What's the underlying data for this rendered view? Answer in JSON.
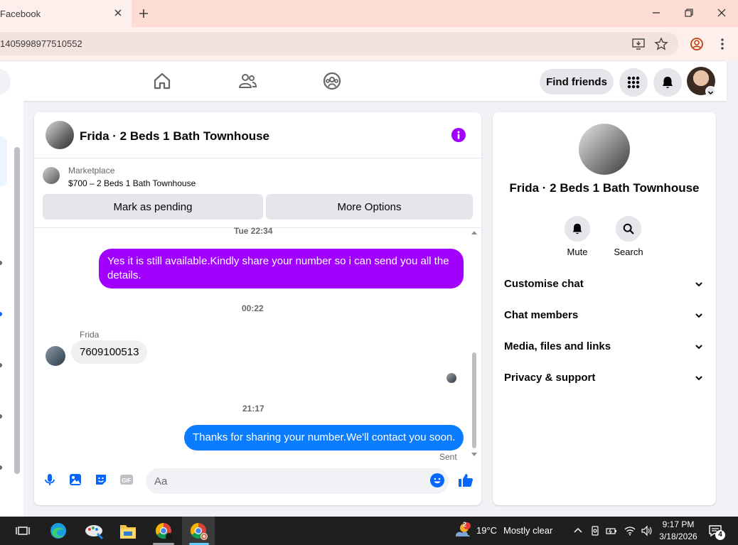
{
  "browser": {
    "tab_title": "Facebook",
    "url": "1405998977510552"
  },
  "fb_nav": {
    "find_friends_label": "Find friends"
  },
  "chat": {
    "title": "Frida · 2 Beds 1 Bath Townhouse",
    "listing": {
      "source": "Marketplace",
      "price_title": "$700 – 2 Beds 1 Bath Townhouse",
      "mark_pending_label": "Mark as pending",
      "more_options_label": "More Options"
    },
    "messages": [
      {
        "type": "timestamp",
        "text": "Tue 22:34"
      },
      {
        "type": "outgoing",
        "color": "#a100ff",
        "text": "Yes it is still available.Kindly share your number so i can send you all the details."
      },
      {
        "type": "timestamp",
        "text": "00:22"
      },
      {
        "type": "incoming",
        "sender": "Frida",
        "text": "7609100513"
      },
      {
        "type": "timestamp",
        "text": "21:17"
      },
      {
        "type": "outgoing",
        "color": "#0a7cff",
        "text": "Thanks for sharing your number.We'll contact you soon.",
        "status": "Sent"
      }
    ],
    "composer": {
      "placeholder": "Aa"
    }
  },
  "info_panel": {
    "name": "Frida · 2 Beds 1 Bath Townhouse",
    "actions": [
      {
        "label": "Mute",
        "icon": "bell-icon"
      },
      {
        "label": "Search",
        "icon": "search-icon"
      }
    ],
    "sections": [
      {
        "label": "Customise chat"
      },
      {
        "label": "Chat members"
      },
      {
        "label": "Media, files and links"
      },
      {
        "label": "Privacy & support"
      }
    ]
  },
  "taskbar": {
    "weather_temp": "19°C",
    "weather_desc": "Mostly clear",
    "weather_badge": "2",
    "time": "9:17 PM",
    "date": "3/18/2026",
    "notification_count": "4"
  },
  "colors": {
    "accent_purple": "#a100ff",
    "accent_blue": "#0a7cff",
    "fb_blue": "#0866ff"
  }
}
